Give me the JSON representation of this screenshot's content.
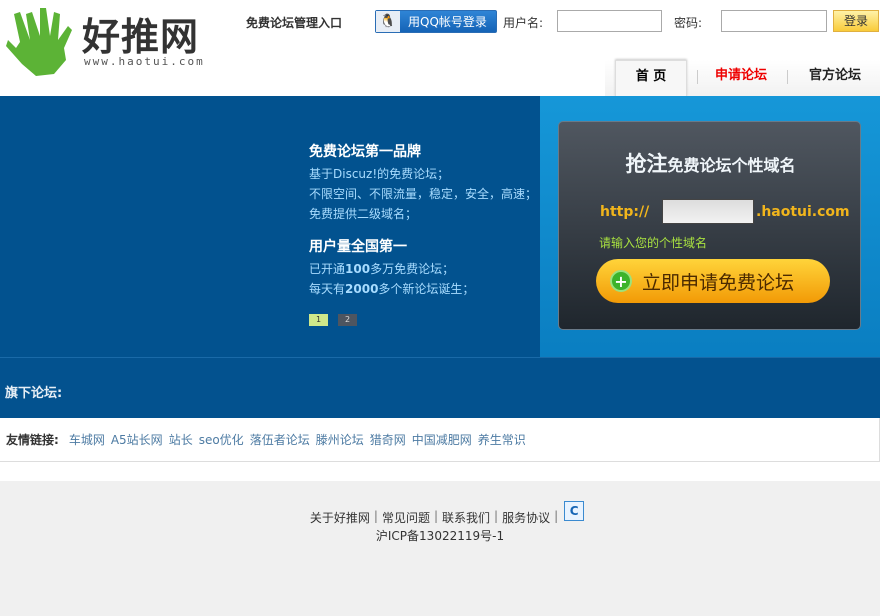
{
  "header": {
    "logo_text": "好推网",
    "logo_url": "www.haotui.com",
    "admin_entry": "免费论坛管理入口",
    "qq_login": "用QQ帐号登录",
    "username_label": "用户名:",
    "username_value": "",
    "password_label": "密码:",
    "password_value": "",
    "login_button": "登录"
  },
  "nav": {
    "tabs": [
      {
        "label": "首 页",
        "active": true
      },
      {
        "label": "申请论坛",
        "color": "#e00000"
      },
      {
        "label": "官方论坛"
      }
    ]
  },
  "banner": {
    "heading1": "免费论坛第一品牌",
    "lines1": [
      "基于Discuz!的免费论坛；",
      "不限空间、不限流量，稳定，安全，高速；",
      "免费提供二级域名；"
    ],
    "heading2": "用户量全国第一",
    "line2a_pre": "已开通",
    "line2a_num": "100",
    "line2a_post": "多万免费论坛；",
    "line2b_pre": "每天有",
    "line2b_num": "2000",
    "line2b_post": "多个新论坛诞生；",
    "pager": [
      "1",
      "2"
    ],
    "active_page": 1
  },
  "card": {
    "title_big": "抢注",
    "title_rest": "免费论坛个性域名",
    "prefix": "http://",
    "domain_value": "",
    "suffix": ".haotui.com",
    "hint": "请输入您的个性域名",
    "apply_button": "立即申请免费论坛"
  },
  "sub_forums": {
    "label": "旗下论坛:"
  },
  "friend_links": {
    "label": "友情链接:",
    "items": [
      "车城网",
      "A5站长网",
      "站长",
      "seo优化",
      "落伍者论坛",
      "滕州论坛",
      "猎奇网",
      "中国减肥网",
      "养生常识"
    ]
  },
  "footer": {
    "links": [
      "关于好推网",
      "常见问题",
      "联系我们",
      "服务协议"
    ],
    "icp": "沪ICP备13022119号-1",
    "stat_icon": "cnzz-icon"
  },
  "colors": {
    "banner_dark": "#02528f",
    "banner_light": "#1697d8",
    "accent_red": "#e00000",
    "domain_yellow": "#f1b51c",
    "hint_green": "#a8e040"
  }
}
